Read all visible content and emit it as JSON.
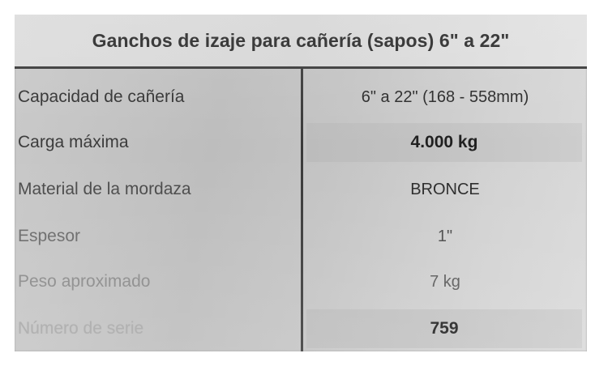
{
  "title": "Ganchos de izaje para cañería (sapos) 6\" a 22\"",
  "rows": [
    {
      "label": "Capacidad de cañería",
      "value": "6\" a 22\" (168 - 558mm)"
    },
    {
      "label": "Carga máxima",
      "value": "4.000 kg"
    },
    {
      "label": "Material de la mordaza",
      "value": "BRONCE"
    },
    {
      "label": "Espesor",
      "value": "1\""
    },
    {
      "label": "Peso aproximado",
      "value": "7 kg"
    },
    {
      "label": "Número de serie",
      "value": "759"
    }
  ]
}
